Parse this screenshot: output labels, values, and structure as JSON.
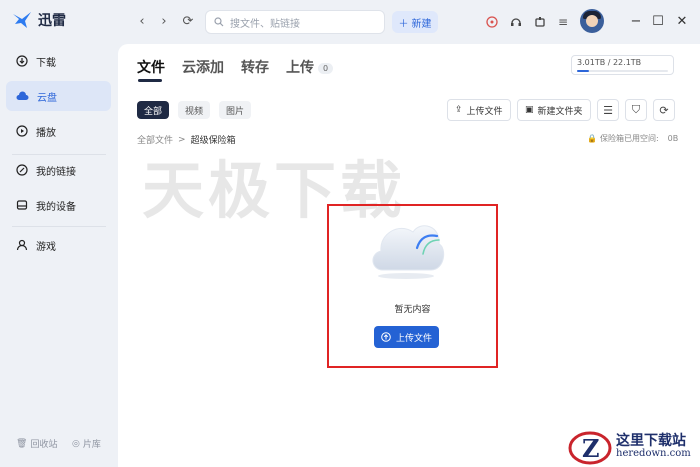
{
  "app": {
    "name": "迅雷"
  },
  "search": {
    "placeholder": "搜文件、贴链接"
  },
  "toolbar": {
    "new_label": "新建"
  },
  "sidebar": {
    "items": [
      {
        "label": "下载",
        "icon": "download-icon"
      },
      {
        "label": "云盘",
        "icon": "cloud-icon",
        "active": true
      },
      {
        "label": "播放",
        "icon": "play-icon"
      },
      {
        "label": "我的链接",
        "icon": "link-icon"
      },
      {
        "label": "我的设备",
        "icon": "device-icon"
      },
      {
        "label": "游戏",
        "icon": "game-icon"
      }
    ],
    "footer": {
      "trash": "回收站",
      "library": "片库"
    }
  },
  "tabs": [
    {
      "label": "文件",
      "active": true
    },
    {
      "label": "云添加"
    },
    {
      "label": "转存"
    },
    {
      "label": "上传",
      "badge": "0"
    }
  ],
  "storage": {
    "text": "3.01TB / 22.1TB",
    "used_fraction": 0.136
  },
  "filters": [
    "全部",
    "视频",
    "图片"
  ],
  "actions": {
    "upload": "上传文件",
    "new_folder": "新建文件夹"
  },
  "breadcrumb": {
    "root": "全部文件",
    "sep": ">",
    "current": "超级保险箱"
  },
  "quota": {
    "label": "保险箱已用空间:",
    "value": "0B"
  },
  "watermark": "天极下载",
  "empty": {
    "text": "暂无内容",
    "button": "上传文件"
  },
  "site_mark": {
    "name": "这里下载站",
    "url": "heredown.com"
  },
  "colors": {
    "accent": "#2462d4",
    "highlight_box": "#e02424"
  }
}
